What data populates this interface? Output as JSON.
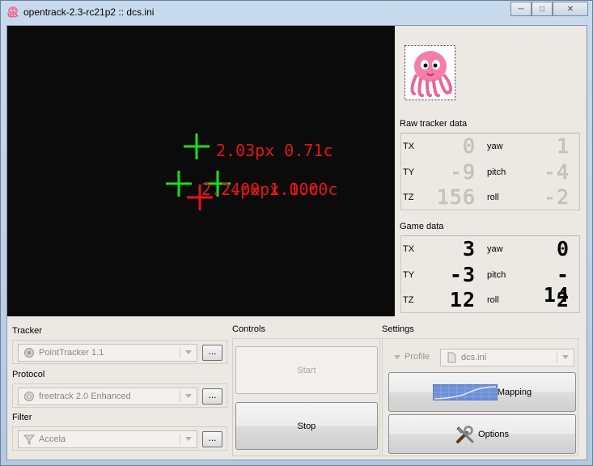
{
  "window": {
    "title": "opentrack-2.3-rc21p2 :: dcs.ini"
  },
  "video": {
    "point_labels": [
      "2.03px 0.71c",
      "2.24px 1.00c",
      "2.00px 1.00c"
    ]
  },
  "raw_tracker": {
    "title": "Raw tracker data",
    "rows": [
      {
        "left_label": "TX",
        "left_value": "0",
        "right_label": "yaw",
        "right_value": "1"
      },
      {
        "left_label": "TY",
        "left_value": "-9",
        "right_label": "pitch",
        "right_value": "-4"
      },
      {
        "left_label": "TZ",
        "left_value": "156",
        "right_label": "roll",
        "right_value": "-2"
      }
    ]
  },
  "game_data": {
    "title": "Game data",
    "rows": [
      {
        "left_label": "TX",
        "left_value": "3",
        "right_label": "yaw",
        "right_value": "0"
      },
      {
        "left_label": "TY",
        "left_value": "-3",
        "right_label": "pitch",
        "right_value": "- 14"
      },
      {
        "left_label": "TZ",
        "left_value": "12",
        "right_label": "roll",
        "right_value": "2"
      }
    ]
  },
  "tracker": {
    "label": "Tracker",
    "value": "PointTracker 1.1",
    "config_button": "..."
  },
  "protocol": {
    "label": "Protocol",
    "value": "freetrack 2.0 Enhanced",
    "config_button": "..."
  },
  "filter": {
    "label": "Filter",
    "value": "Accela",
    "config_button": "..."
  },
  "controls": {
    "label": "Controls",
    "start": "Start",
    "stop": "Stop"
  },
  "settings": {
    "label": "Settings",
    "profile_label": "Profile",
    "profile_value": "dcs.ini",
    "mapping": "Mapping",
    "options": "Options"
  },
  "colors": {
    "accent_green": "#19e019",
    "accent_red": "#e61414"
  },
  "icons": {
    "app": "octopus-icon",
    "mapping": "curve-graph-icon",
    "options": "tools-icon"
  }
}
